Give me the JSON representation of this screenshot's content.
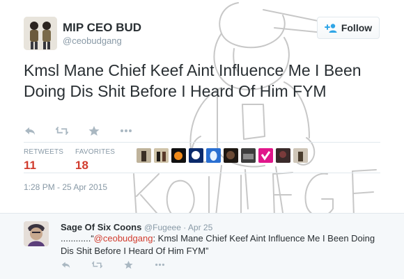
{
  "user": {
    "display_name": "MIP CEO BUD",
    "handle": "@ceobudgang",
    "follow_label": "Follow"
  },
  "tweet": {
    "text": "Kmsl Mane Chief Keef Aint Influence Me I Been Doing Dis Shit Before I Heard Of Him FYM",
    "timestamp": "1:28 PM - 25 Apr 2015"
  },
  "stats": {
    "retweets_label": "RETWEETS",
    "retweets": "11",
    "favorites_label": "FAVORITES",
    "favorites": "18"
  },
  "actions": [
    "reply-icon",
    "retweet-icon",
    "favorite-icon",
    "more-icon"
  ],
  "favoriter_avatar_count": 10,
  "reply": {
    "display_name": "Sage Of Six Coons",
    "handle": "@Fugeee",
    "separator": "·",
    "date": "Apr 25",
    "text_prefix": "............“",
    "mention": "@ceobudgang",
    "text_rest": ": Kmsl Mane Chief Keef Aint Influence Me I Been Doing Dis Shit Before I Heard Of Him FYM”"
  },
  "watermark": {
    "text": "KOLLEGE KIDD"
  },
  "colors": {
    "accent": "#d13c2e",
    "muted": "#8899a6",
    "text": "#292f33",
    "follow_icon": "#2fa5e6"
  }
}
